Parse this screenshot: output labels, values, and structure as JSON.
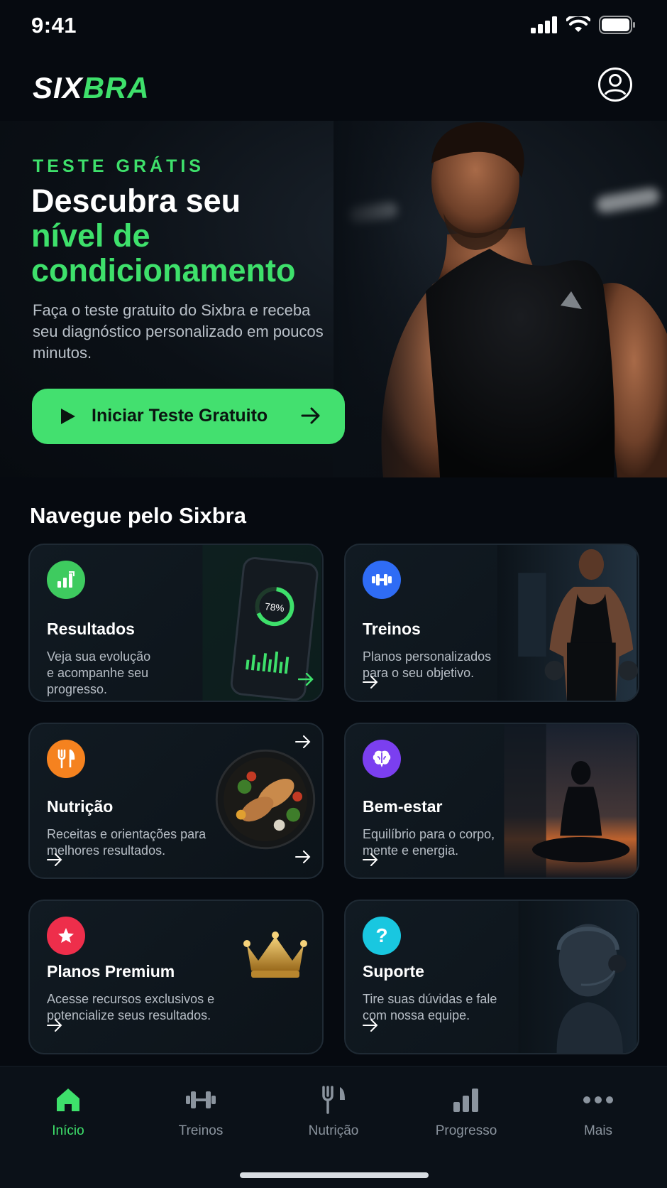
{
  "status_bar": {
    "time": "9:41"
  },
  "header": {
    "logo_part1": "SIX",
    "logo_part2": "BRA"
  },
  "hero": {
    "eyebrow": "TESTE GRÁTIS",
    "title_line1": "Descubra seu",
    "title_line2": "nível de",
    "title_line3": "condicionamento",
    "description": "Faça o teste gratuito do Sixbra e receba seu diagnóstico personalizado em poucos minutos.",
    "cta_label": "Iniciar Teste Gratuito"
  },
  "section": {
    "title": "Navegue pelo Sixbra"
  },
  "cards": [
    {
      "title": "Resultados",
      "description": "Veja sua evolução e acompanhe seu progresso.",
      "icon": "bar-chart-icon",
      "color": "#3ecb5f",
      "art_text": "78%"
    },
    {
      "title": "Treinos",
      "description": "Planos personalizados para o seu objetivo.",
      "icon": "dumbbell-icon",
      "color": "#2f6cf5"
    },
    {
      "title": "Nutrição",
      "description": "Receitas e orientações para melhores resultados.",
      "icon": "fork-knife-icon",
      "color": "#f5821f"
    },
    {
      "title": "Bem-estar",
      "description": "Equilíbrio para o corpo, mente e energia.",
      "icon": "brain-icon",
      "color": "#7b3ff0"
    },
    {
      "title": "Planos Premium",
      "description": "Acesse recursos exclusivos e potencialize seus resultados.",
      "icon": "star-icon",
      "color": "#ee2e4b"
    },
    {
      "title": "Suporte",
      "description": "Tire suas dúvidas e fale com nossa equipe.",
      "icon": "question-icon",
      "color": "#19c7e0"
    }
  ],
  "bottom_nav": [
    {
      "label": "Início",
      "icon": "home-icon",
      "active": true
    },
    {
      "label": "Treinos",
      "icon": "dumbbell-icon",
      "active": false
    },
    {
      "label": "Nutrição",
      "icon": "fork-knife-icon",
      "active": false
    },
    {
      "label": "Progresso",
      "icon": "bar-chart-icon",
      "active": false
    },
    {
      "label": "Mais",
      "icon": "more-icon",
      "active": false
    }
  ],
  "colors": {
    "accent": "#3ee06b",
    "background": "#060a10",
    "card_border": "#1f2a34"
  }
}
